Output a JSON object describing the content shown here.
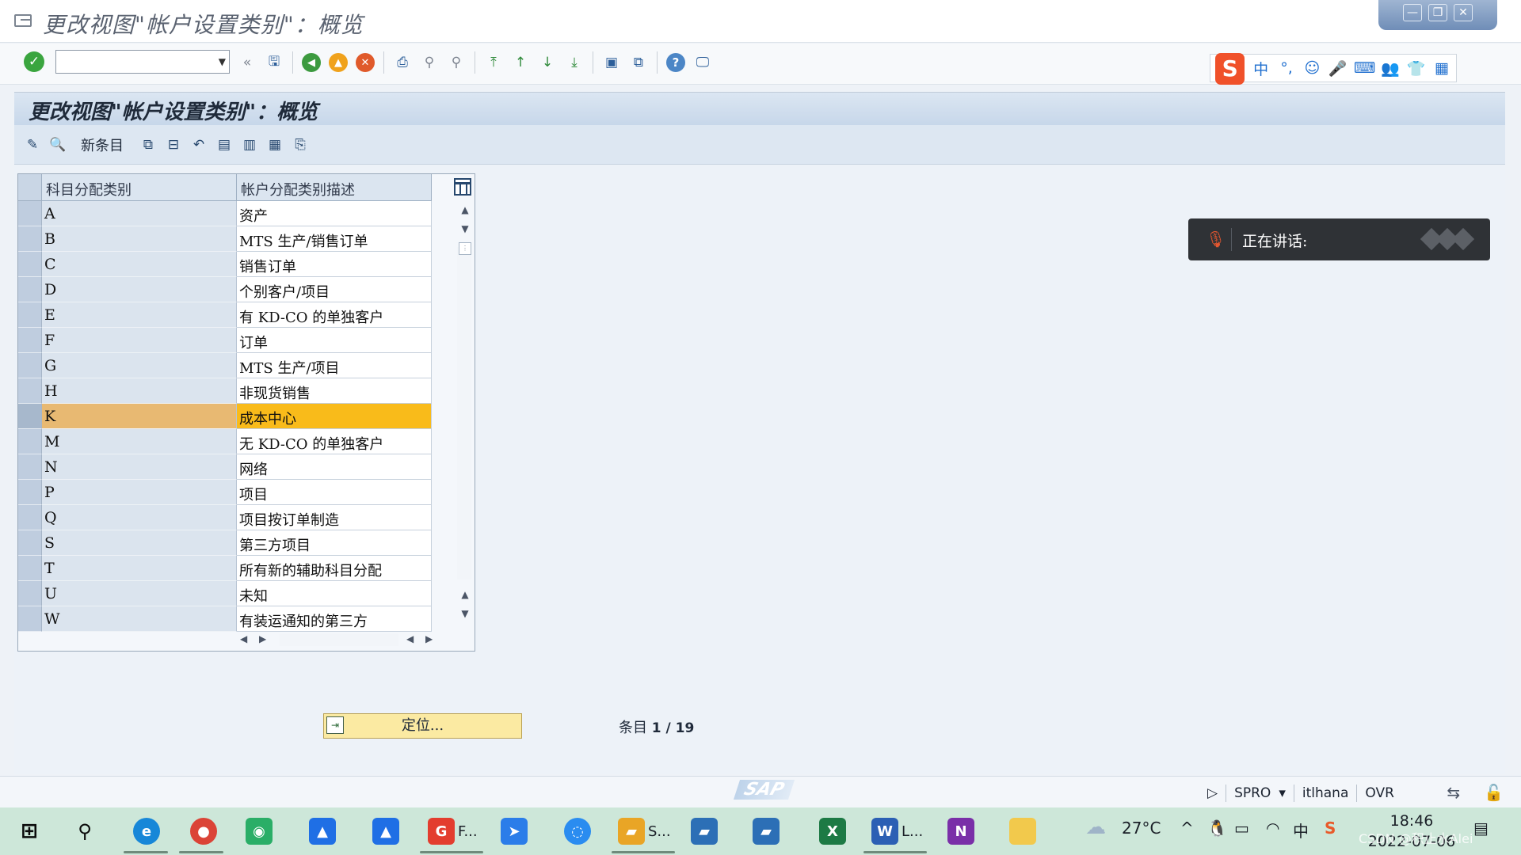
{
  "window": {
    "title": "更改视图\"帐户设置类别\"：概览",
    "controls": [
      "—",
      "❐",
      "✕"
    ]
  },
  "std_toolbar": {
    "command_value": "",
    "icons": [
      "enter-icon",
      "save-icon",
      "back-icon",
      "exit-icon",
      "cancel-icon",
      "print-icon",
      "find-icon",
      "find-next-icon",
      "first-page-icon",
      "previous-page-icon",
      "next-page-icon",
      "last-page-icon",
      "create-session-icon",
      "shortcut-icon",
      "help-icon",
      "customize-layout-icon"
    ]
  },
  "ime_toolbar": {
    "logo": "S",
    "items": [
      "中",
      "°,",
      "☺",
      "🎤",
      "⌨",
      "👥",
      "👕",
      "▦"
    ]
  },
  "screen": {
    "title": "更改视图\"帐户设置类别\"：概览"
  },
  "app_toolbar": {
    "new_entries_label": "新条目"
  },
  "table": {
    "columns": [
      "科目分配类别",
      "帐户分配类别描述"
    ],
    "rows": [
      {
        "code": "A",
        "desc": "资产"
      },
      {
        "code": "B",
        "desc": "MTS 生产/销售订单"
      },
      {
        "code": "C",
        "desc": "销售订单"
      },
      {
        "code": "D",
        "desc": "个别客户/项目"
      },
      {
        "code": "E",
        "desc": "有 KD-CO 的单独客户"
      },
      {
        "code": "F",
        "desc": "订单"
      },
      {
        "code": "G",
        "desc": "MTS 生产/项目"
      },
      {
        "code": "H",
        "desc": "非现货销售"
      },
      {
        "code": "K",
        "desc": "成本中心",
        "highlighted": true
      },
      {
        "code": "M",
        "desc": "无 KD-CO 的单独客户"
      },
      {
        "code": "N",
        "desc": "网络"
      },
      {
        "code": "P",
        "desc": "项目"
      },
      {
        "code": "Q",
        "desc": "项目按订单制造"
      },
      {
        "code": "S",
        "desc": "第三方项目"
      },
      {
        "code": "T",
        "desc": "所有新的辅助科目分配"
      },
      {
        "code": "U",
        "desc": "未知"
      },
      {
        "code": "W",
        "desc": "有装运通知的第三方"
      }
    ]
  },
  "footer": {
    "locate_button": "定位...",
    "entry_label": "条目",
    "entry_value": "1 / 19"
  },
  "speaking_panel": {
    "label": "正在讲话:"
  },
  "statusbar": {
    "sap_logo": "SAP",
    "transaction": "SPRO",
    "server": "itlhana",
    "mode": "OVR"
  },
  "taskbar": {
    "apps": [
      {
        "label": "F..."
      },
      {
        "label": "S..."
      },
      {
        "label": "L..."
      }
    ],
    "weather": "27°C",
    "ime_indicator": "中",
    "time": "18:46",
    "date": "2022-07-06",
    "watermark": "CSDN @积止水Alei"
  },
  "colors": {
    "highlight_row": "#f9bb1a",
    "highlight_key": "#e8b972",
    "title_bar": "#c7d7ea",
    "taskbar": "#cde7d9"
  }
}
